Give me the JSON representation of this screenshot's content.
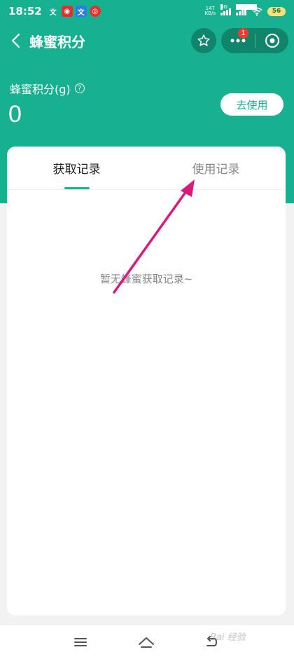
{
  "status_bar": {
    "time": "18:52",
    "net_speed_value": "147",
    "net_speed_unit": "KB/s",
    "signal1_label": "3G",
    "signal2_label": "5G HD",
    "battery_level": "56"
  },
  "nav": {
    "title": "蜂蜜积分",
    "more_badge": "1"
  },
  "points": {
    "label": "蜂蜜积分(g)",
    "help_mark": "?",
    "value": "0",
    "use_button_label": "去使用"
  },
  "tabs": [
    {
      "label": "获取记录",
      "active": true
    },
    {
      "label": "使用记录",
      "active": false
    }
  ],
  "empty_state": "暂无蜂蜜获取记录~",
  "colors": {
    "accent": "#17b191",
    "badge": "#ef3b2d",
    "annotation_arrow": "#d81b7a"
  },
  "watermark": "Bai 经验"
}
